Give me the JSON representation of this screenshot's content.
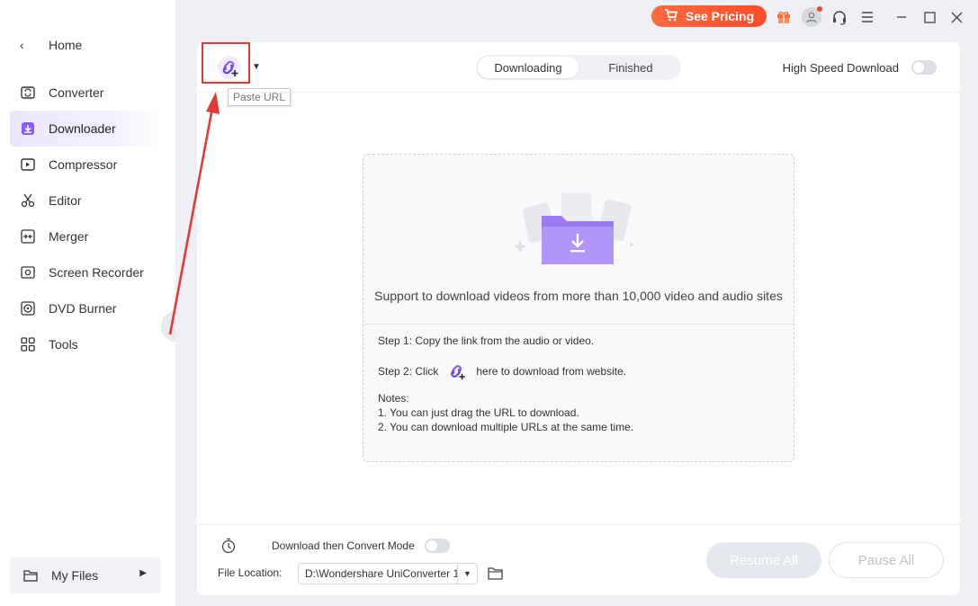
{
  "sidebar": {
    "home_label": "Home",
    "items": [
      {
        "label": "Converter",
        "icon": "converter-icon"
      },
      {
        "label": "Downloader",
        "icon": "downloader-icon",
        "active": true
      },
      {
        "label": "Compressor",
        "icon": "compressor-icon"
      },
      {
        "label": "Editor",
        "icon": "scissors-icon"
      },
      {
        "label": "Merger",
        "icon": "merger-icon"
      },
      {
        "label": "Screen Recorder",
        "icon": "screen-recorder-icon"
      },
      {
        "label": "DVD Burner",
        "icon": "disc-icon"
      },
      {
        "label": "Tools",
        "icon": "tools-grid-icon"
      }
    ],
    "my_files_label": "My Files"
  },
  "titlebar": {
    "pricing_label": "See Pricing"
  },
  "toolbar": {
    "paste_tooltip": "Paste URL",
    "tabs": [
      {
        "label": "Downloading",
        "active": true
      },
      {
        "label": "Finished",
        "active": false
      }
    ],
    "high_speed_label": "High Speed Download",
    "high_speed_enabled": false
  },
  "dropzone": {
    "support_text": "Support to download videos from more than 10,000 video and audio sites",
    "step1": "Step 1: Copy the link from the audio or video.",
    "step2_prefix": "Step 2: Click",
    "step2_suffix": "here to download from website.",
    "notes_title": "Notes:",
    "note1": "1. You can just drag the URL to download.",
    "note2": "2. You can download multiple URLs at the same time."
  },
  "bottom": {
    "convert_mode_label": "Download then Convert Mode",
    "convert_mode_enabled": false,
    "file_location_label": "File Location:",
    "file_location_value": "D:\\Wondershare UniConverter 1",
    "resume_label": "Resume All",
    "pause_label": "Pause All"
  },
  "colors": {
    "accent": "#8a5cf6",
    "pricing": "#ff5533",
    "annotation_red": "#e53935"
  }
}
